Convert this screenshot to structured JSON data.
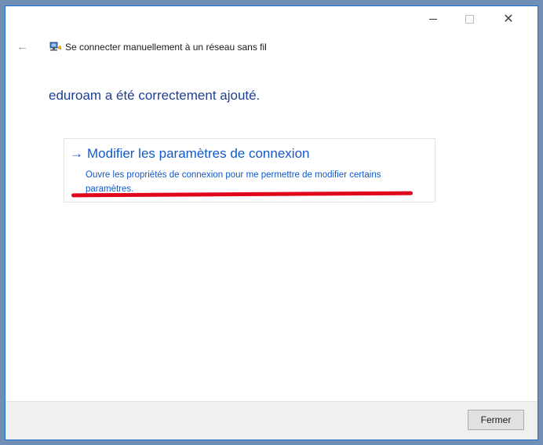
{
  "window": {
    "title": "Se connecter manuellement à un réseau sans fil",
    "back_glyph": "←",
    "close_glyph": "✕"
  },
  "main": {
    "message": "eduroam a été correctement ajouté."
  },
  "link": {
    "arrow": "→",
    "heading": "Modifier les paramètres de connexion",
    "description": "Ouvre les propriétés de connexion pour me permettre de modifier certains paramètres."
  },
  "footer": {
    "close_label": "Fermer"
  },
  "colors": {
    "accent_blue": "#1459c6",
    "message_blue": "#1e3f94",
    "annotation_red": "#e0061b"
  }
}
